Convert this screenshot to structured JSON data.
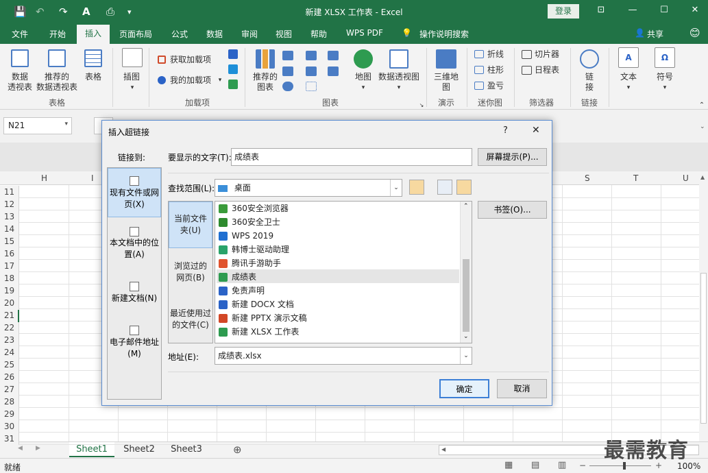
{
  "window": {
    "title": "新建 XLSX 工作表 - Excel",
    "login": "登录",
    "share": "共享"
  },
  "tabs": [
    "文件",
    "开始",
    "插入",
    "页面布局",
    "公式",
    "数据",
    "审阅",
    "视图",
    "帮助",
    "WPS PDF",
    "操作说明搜索"
  ],
  "ribbon": {
    "pivot": "数据\n透视表",
    "recommended_pivot": "推荐的\n数据透视表",
    "table": "表格",
    "group_tables": "表格",
    "illustrations": "插图",
    "get_addins": "获取加载项",
    "my_addins": "我的加载项",
    "group_addins": "加载项",
    "recommended_charts": "推荐的\n图表",
    "maps": "地图",
    "pivot_chart": "数据透视图",
    "group_charts": "图表",
    "map3d": "三维地\n图",
    "group_tours": "演示",
    "line": "折线",
    "column": "柱形",
    "winloss": "盈亏",
    "group_sparklines": "迷你图",
    "slicer": "切片器",
    "timeline": "日程表",
    "group_filters": "筛选器",
    "link": "链\n接",
    "group_links": "链接",
    "text": "文本",
    "symbol": "符号"
  },
  "namebox": "N21",
  "columns": [
    "H",
    "I",
    "S",
    "T",
    "U"
  ],
  "rows": [
    "11",
    "12",
    "13",
    "14",
    "15",
    "16",
    "17",
    "18",
    "19",
    "20",
    "21",
    "22",
    "23",
    "24",
    "25",
    "26",
    "27",
    "28",
    "29",
    "30",
    "31"
  ],
  "sheets": [
    "Sheet1",
    "Sheet2",
    "Sheet3"
  ],
  "status": {
    "ready": "就绪",
    "zoom": "100%"
  },
  "watermark": "最需教育",
  "dialog": {
    "title": "插入超链接",
    "help": "?",
    "close": "✕",
    "link_to": "链接到:",
    "display_text_label": "要显示的文字(T):",
    "display_text": "成绩表",
    "screentip": "屏幕提示(P)...",
    "look_in_label": "查找范围(L):",
    "look_in": "桌面",
    "bookmark": "书签(O)...",
    "address_label": "地址(E):",
    "address": "成绩表.xlsx",
    "ok": "确定",
    "cancel": "取消",
    "nav": [
      "现有文件或网\n页(X)",
      "本文档中的位\n置(A)",
      "新建文档(N)",
      "电子邮件地址\n(M)"
    ],
    "mid": [
      "当前文件\n夹(U)",
      "浏览过的\n网页(B)",
      "最近使用过\n的文件(C)"
    ],
    "files": [
      {
        "name": "360安全浏览器",
        "color": "#3a9b3a"
      },
      {
        "name": "360安全卫士",
        "color": "#2e8b2e"
      },
      {
        "name": "WPS 2019",
        "color": "#1f6fd1"
      },
      {
        "name": "韩博士驱动助理",
        "color": "#2aa36a"
      },
      {
        "name": "腾讯手游助手",
        "color": "#e0532e"
      },
      {
        "name": "成绩表",
        "color": "#2e9b50"
      },
      {
        "name": "免责声明",
        "color": "#2b63c7"
      },
      {
        "name": "新建 DOCX 文档",
        "color": "#2b63c7"
      },
      {
        "name": "新建 PPTX 演示文稿",
        "color": "#d24726"
      },
      {
        "name": "新建 XLSX 工作表",
        "color": "#2e9b50"
      }
    ]
  }
}
